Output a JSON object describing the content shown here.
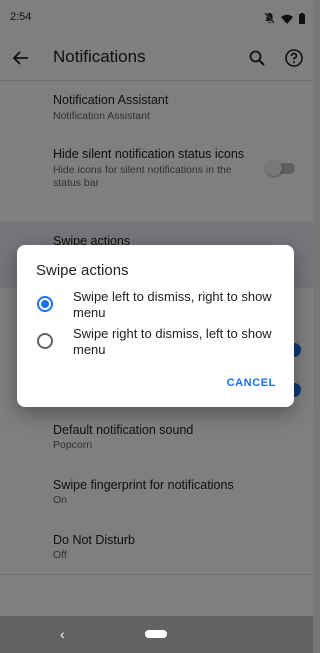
{
  "status_bar": {
    "time": "2:54",
    "icons": [
      "notifications-off-icon",
      "wifi-icon",
      "battery-icon"
    ]
  },
  "app_bar": {
    "title": "Notifications",
    "icons": [
      "back-arrow-icon",
      "search-icon",
      "help-icon"
    ]
  },
  "settings": {
    "items": [
      {
        "title": "Notification Assistant",
        "subtitle": "Notification Assistant"
      },
      {
        "title": "Hide silent notification status icons",
        "subtitle": "Hide icons for silent notifications in the status bar",
        "toggle_on": false
      },
      {
        "title": "Swipe actions"
      },
      {
        "title": "Default notification sound",
        "subtitle": "Popcorn"
      },
      {
        "title": "Swipe fingerprint for notifications",
        "subtitle": "On"
      },
      {
        "title": "Do Not Disturb",
        "subtitle": "Off"
      }
    ]
  },
  "dialog": {
    "title": "Swipe actions",
    "options": [
      {
        "label": "Swipe left to dismiss, right to show menu",
        "selected": true
      },
      {
        "label": "Swipe right to dismiss, left to show menu",
        "selected": false
      }
    ],
    "cancel_label": "CANCEL"
  },
  "nav_bar": {
    "back_glyph": "‹"
  },
  "colors": {
    "accent": "#1a73e8",
    "text_primary": "#202124",
    "text_secondary": "#5f6368",
    "scrim": "rgba(0,0,0,0.5)"
  }
}
